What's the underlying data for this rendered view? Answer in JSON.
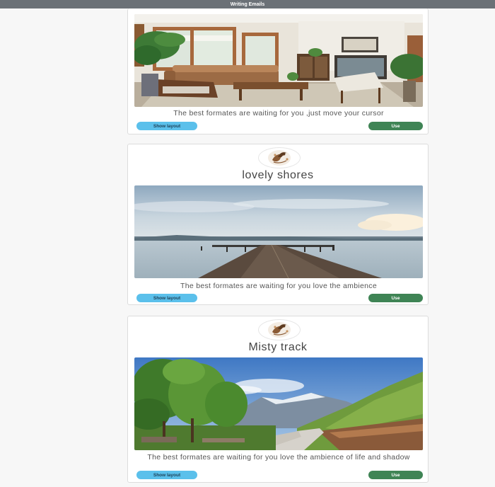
{
  "app": {
    "title": "Writing Emails"
  },
  "colors": {
    "topbar": "#6b7177",
    "show_layout_button": "#5bc0eb",
    "use_button": "#3f8455"
  },
  "cards": [
    {
      "title": "",
      "image": "living-room-photo",
      "caption": "The best formates are waiting for you ,just move your cursor",
      "show_layout_label": "Show layout",
      "use_label": "Use"
    },
    {
      "title": "lovely shores",
      "logo": "bird-emblem-icon",
      "image": "pier-lake-photo",
      "caption": "The best formates are waiting for you love the ambience",
      "show_layout_label": "Show layout",
      "use_label": "Use"
    },
    {
      "title": "Misty track",
      "logo": "bird-emblem-icon",
      "image": "mountain-road-photo",
      "caption": "The best formates are waiting for you love the ambience of life and shadow",
      "show_layout_label": "Show layout",
      "use_label": "Use"
    }
  ]
}
